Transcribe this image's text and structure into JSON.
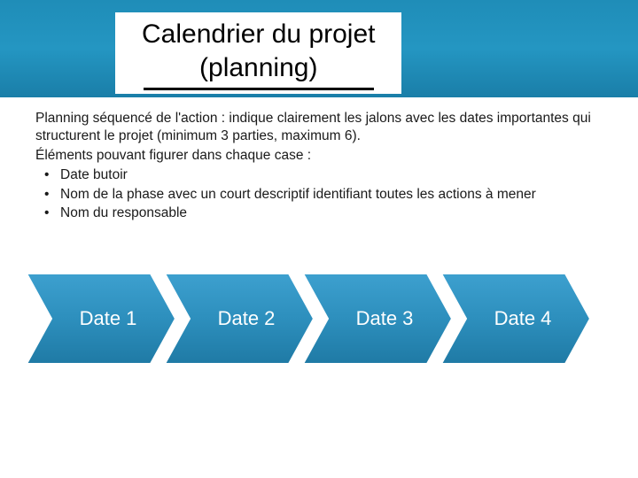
{
  "title": {
    "line1": "Calendrier du projet",
    "line2": "(planning)"
  },
  "intro": {
    "p1": "Planning séquencé de l'action : indique clairement les jalons avec les dates importantes qui structurent le projet (minimum 3 parties, maximum 6).",
    "p2": "Éléments pouvant figurer dans chaque case :"
  },
  "bullets": [
    "Date butoir",
    "Nom de la phase avec un court descriptif identifiant toutes les actions à mener",
    "Nom du responsable"
  ],
  "chevrons": [
    {
      "label": "Date 1"
    },
    {
      "label": "Date 2"
    },
    {
      "label": "Date 3"
    },
    {
      "label": "Date 4"
    }
  ],
  "colors": {
    "chevronFill": "#2d8fbd",
    "chevronStroke": "#ffffff"
  }
}
